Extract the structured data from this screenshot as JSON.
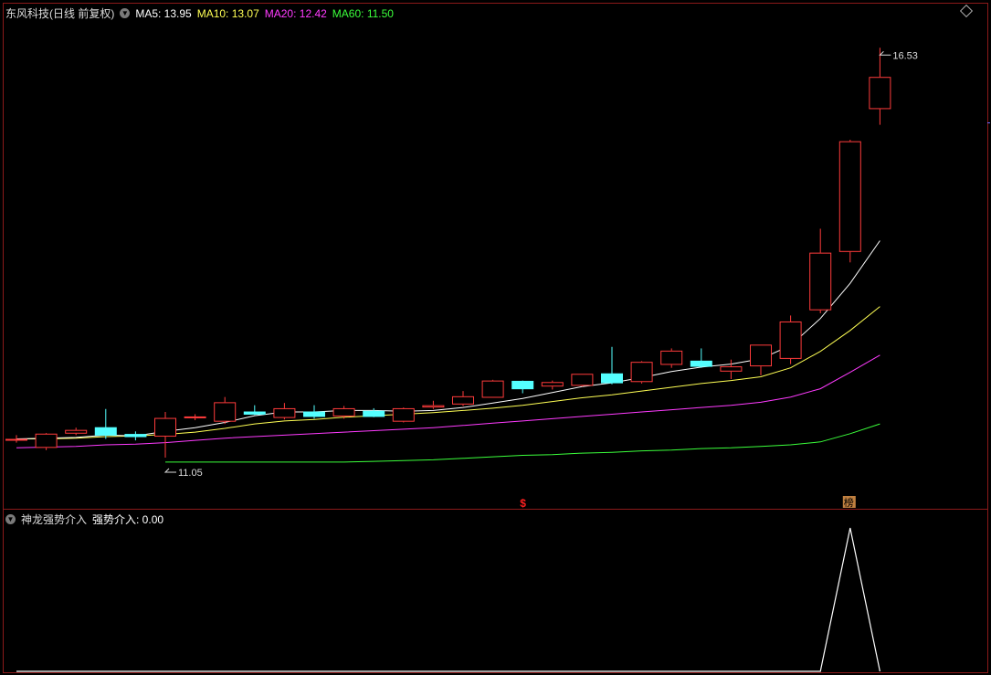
{
  "header": {
    "title": "东风科技(日线 前复权)",
    "ma5": "MA5: 13.95",
    "ma10": "MA10: 13.07",
    "ma20": "MA20: 12.42",
    "ma60": "MA60: 11.50"
  },
  "indicator_header": {
    "name": "神龙强势介入",
    "value": "强势介入: 0.00"
  },
  "colors": {
    "up": "#ff3b3b",
    "down": "#54ffff",
    "ma5": "#ffffff",
    "ma10": "#ffff54",
    "ma20": "#ff3bff",
    "ma60": "#3bff3b",
    "indicator": "#ffffff",
    "marker_s": "#ff2020",
    "marker_bang": "#c08040"
  },
  "annotations": {
    "high_label": "16.53",
    "low_label": "11.05",
    "marker_s": "$",
    "marker_bang": "榜"
  },
  "chart_data": [
    {
      "type": "candlestick",
      "title": "东风科技(日线 前复权)",
      "ylim": [
        10.5,
        16.9
      ],
      "candles": [
        {
          "o": 11.3,
          "c": 11.3,
          "h": 11.35,
          "l": 11.25
        },
        {
          "o": 11.18,
          "c": 11.37,
          "h": 11.38,
          "l": 11.15
        },
        {
          "o": 11.37,
          "c": 11.42,
          "h": 11.45,
          "l": 11.35
        },
        {
          "o": 11.45,
          "c": 11.35,
          "h": 11.7,
          "l": 11.3
        },
        {
          "o": 11.36,
          "c": 11.33,
          "h": 11.4,
          "l": 11.28
        },
        {
          "o": 11.33,
          "c": 11.58,
          "h": 11.66,
          "l": 11.05
        },
        {
          "o": 11.58,
          "c": 11.6,
          "h": 11.63,
          "l": 11.55
        },
        {
          "o": 11.53,
          "c": 11.79,
          "h": 11.86,
          "l": 11.5
        },
        {
          "o": 11.66,
          "c": 11.63,
          "h": 11.75,
          "l": 11.62
        },
        {
          "o": 11.58,
          "c": 11.71,
          "h": 11.78,
          "l": 11.56
        },
        {
          "o": 11.66,
          "c": 11.6,
          "h": 11.75,
          "l": 11.57
        },
        {
          "o": 11.6,
          "c": 11.71,
          "h": 11.74,
          "l": 11.57
        },
        {
          "o": 11.67,
          "c": 11.6,
          "h": 11.71,
          "l": 11.59
        },
        {
          "o": 11.53,
          "c": 11.71,
          "h": 11.72,
          "l": 11.52
        },
        {
          "o": 11.72,
          "c": 11.75,
          "h": 11.81,
          "l": 11.7
        },
        {
          "o": 11.76,
          "c": 11.87,
          "h": 11.94,
          "l": 11.74
        },
        {
          "o": 11.85,
          "c": 12.08,
          "h": 12.09,
          "l": 11.85
        },
        {
          "o": 12.07,
          "c": 11.97,
          "h": 12.08,
          "l": 11.91
        },
        {
          "o": 12.0,
          "c": 12.06,
          "h": 12.08,
          "l": 11.96
        },
        {
          "o": 12.01,
          "c": 12.17,
          "h": 12.17,
          "l": 12.0
        },
        {
          "o": 12.17,
          "c": 12.05,
          "h": 12.53,
          "l": 12.03
        },
        {
          "o": 12.06,
          "c": 12.33,
          "h": 12.34,
          "l": 12.04
        },
        {
          "o": 12.29,
          "c": 12.48,
          "h": 12.51,
          "l": 12.25
        },
        {
          "o": 12.34,
          "c": 12.27,
          "h": 12.51,
          "l": 12.25
        },
        {
          "o": 12.2,
          "c": 12.27,
          "h": 12.36,
          "l": 12.1
        },
        {
          "o": 12.27,
          "c": 12.56,
          "h": 12.56,
          "l": 12.15
        },
        {
          "o": 12.37,
          "c": 12.87,
          "h": 12.95,
          "l": 12.3
        },
        {
          "o": 13.02,
          "c": 13.79,
          "h": 14.11,
          "l": 12.98
        },
        {
          "o": 13.8,
          "c": 15.28,
          "h": 15.3,
          "l": 13.66
        },
        {
          "o": 15.71,
          "c": 16.14,
          "h": 16.53,
          "l": 15.5
        }
      ],
      "ma5": [
        11.3,
        11.31,
        11.32,
        11.35,
        11.34,
        11.4,
        11.45,
        11.52,
        11.61,
        11.66,
        11.66,
        11.68,
        11.68,
        11.67,
        11.68,
        11.72,
        11.78,
        11.84,
        11.92,
        12.0,
        12.05,
        12.12,
        12.2,
        12.26,
        12.3,
        12.37,
        12.55,
        12.91,
        13.38,
        13.95
      ],
      "ma10": [
        11.3,
        11.3,
        11.31,
        11.33,
        11.34,
        11.36,
        11.39,
        11.44,
        11.5,
        11.54,
        11.56,
        11.59,
        11.61,
        11.63,
        11.65,
        11.68,
        11.71,
        11.75,
        11.8,
        11.85,
        11.89,
        11.94,
        11.99,
        12.04,
        12.08,
        12.13,
        12.25,
        12.47,
        12.75,
        13.07
      ],
      "ma20": [
        11.18,
        11.19,
        11.2,
        11.22,
        11.23,
        11.25,
        11.28,
        11.31,
        11.33,
        11.35,
        11.37,
        11.39,
        11.41,
        11.43,
        11.45,
        11.48,
        11.51,
        11.54,
        11.57,
        11.6,
        11.63,
        11.66,
        11.69,
        11.72,
        11.75,
        11.79,
        11.86,
        11.97,
        12.19,
        12.42
      ],
      "ma60": [
        null,
        null,
        null,
        null,
        null,
        10.99,
        10.99,
        10.99,
        10.99,
        10.99,
        10.99,
        10.99,
        11.0,
        11.01,
        11.02,
        11.04,
        11.06,
        11.08,
        11.09,
        11.11,
        11.12,
        11.14,
        11.15,
        11.17,
        11.18,
        11.2,
        11.22,
        11.26,
        11.37,
        11.5
      ]
    },
    {
      "type": "line",
      "title": "神龙强势介入",
      "ylim": [
        0,
        1
      ],
      "series": [
        {
          "name": "强势介入",
          "values": [
            0,
            0,
            0,
            0,
            0,
            0,
            0,
            0,
            0,
            0,
            0,
            0,
            0,
            0,
            0,
            0,
            0,
            0,
            0,
            0,
            0,
            0,
            0,
            0,
            0,
            0,
            0,
            0,
            1,
            0
          ]
        }
      ]
    }
  ]
}
